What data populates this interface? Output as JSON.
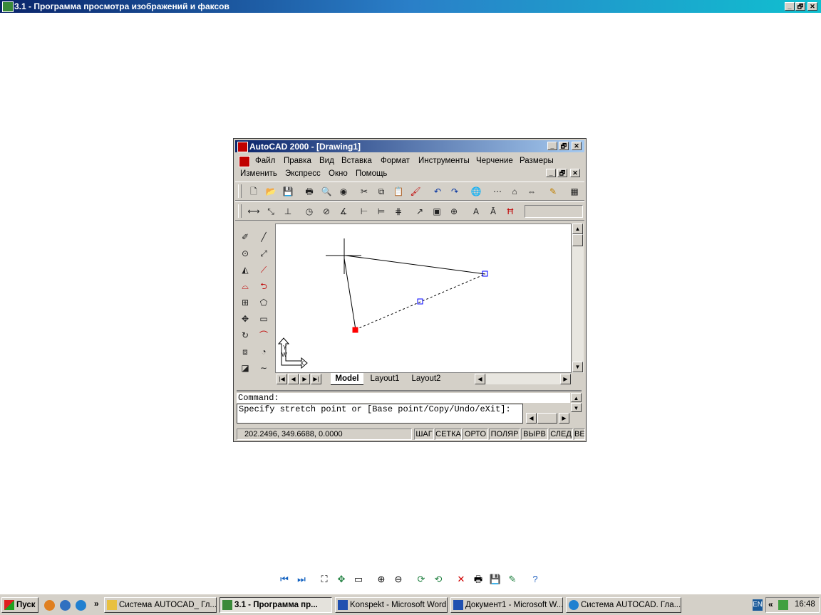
{
  "viewer": {
    "title": "3.1 - Программа просмотра изображений и факсов",
    "min": "_",
    "max": "🗗",
    "close": "✕"
  },
  "acad": {
    "title": "AutoCAD 2000 - [Drawing1]",
    "menu_row1": [
      "Файл",
      "Правка",
      "Вид",
      "Вставка",
      "Формат",
      "Инструменты",
      "Черчение",
      "Размеры"
    ],
    "menu_row2": [
      "Изменить",
      "Экспресс",
      "Окно",
      "Помощь"
    ],
    "tabs": [
      "Model",
      "Layout1",
      "Layout2"
    ],
    "command_line": "Command:",
    "command_history": "Specify stretch point or [Base point/Copy/Undo/eXit]:",
    "coords": "202.2496, 349.6688, 0.0000",
    "status_buttons": [
      "ШАГ",
      "СЕТКА",
      "ОРТО",
      "ПОЛЯР",
      "ВЫРВ",
      "СЛЕД",
      "ВЕ"
    ],
    "ucs_x": "X",
    "ucs_y": "Y",
    "ucs_w": "W"
  },
  "taskbar": {
    "start": "Пуск",
    "tasks": [
      "Система AUTOCAD_ Гл...",
      "3.1 - Программа пр...",
      "Konspekt - Microsoft Word",
      "Документ1 - Microsoft W...",
      "Система AUTOCAD. Гла..."
    ],
    "lang": "EN",
    "clock": "16:48",
    "more": "»",
    "tray_more": "«"
  },
  "icons": {
    "accent": "#0a246a",
    "selected_grip": "#ff0000",
    "grip": "#0000ff"
  }
}
